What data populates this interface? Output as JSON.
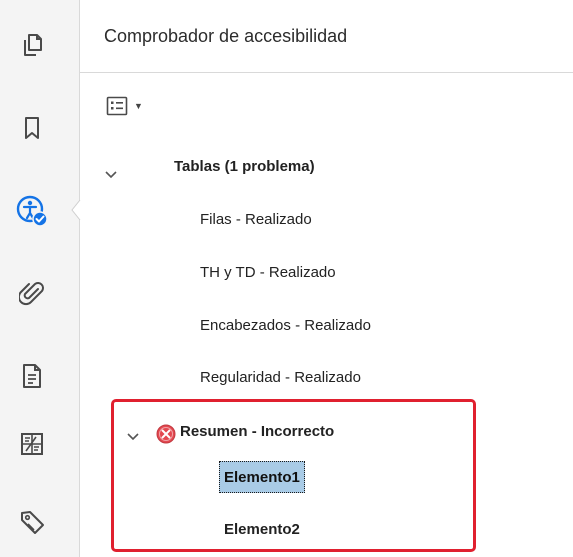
{
  "panel": {
    "title": "Comprobador de accesibilidad"
  },
  "rail": {
    "icons": [
      "pages-icon",
      "bookmark-icon",
      "accessibility-checker-icon",
      "attachment-icon",
      "document-icon",
      "content-icon",
      "tag-icon"
    ]
  },
  "tree": {
    "group_label": "Tablas (1 problema)",
    "items": [
      "Filas - Realizado",
      "TH y TD - Realizado",
      "Encabezados - Realizado",
      "Regularidad - Realizado"
    ],
    "failed_item": "Resumen - Incorrecto",
    "children": [
      "Elemento1",
      "Elemento2"
    ]
  },
  "colors": {
    "accent_blue": "#1473e6",
    "error_red": "#e34850",
    "highlight_border": "#e0202f",
    "selection_bg": "#a9cbe6"
  }
}
